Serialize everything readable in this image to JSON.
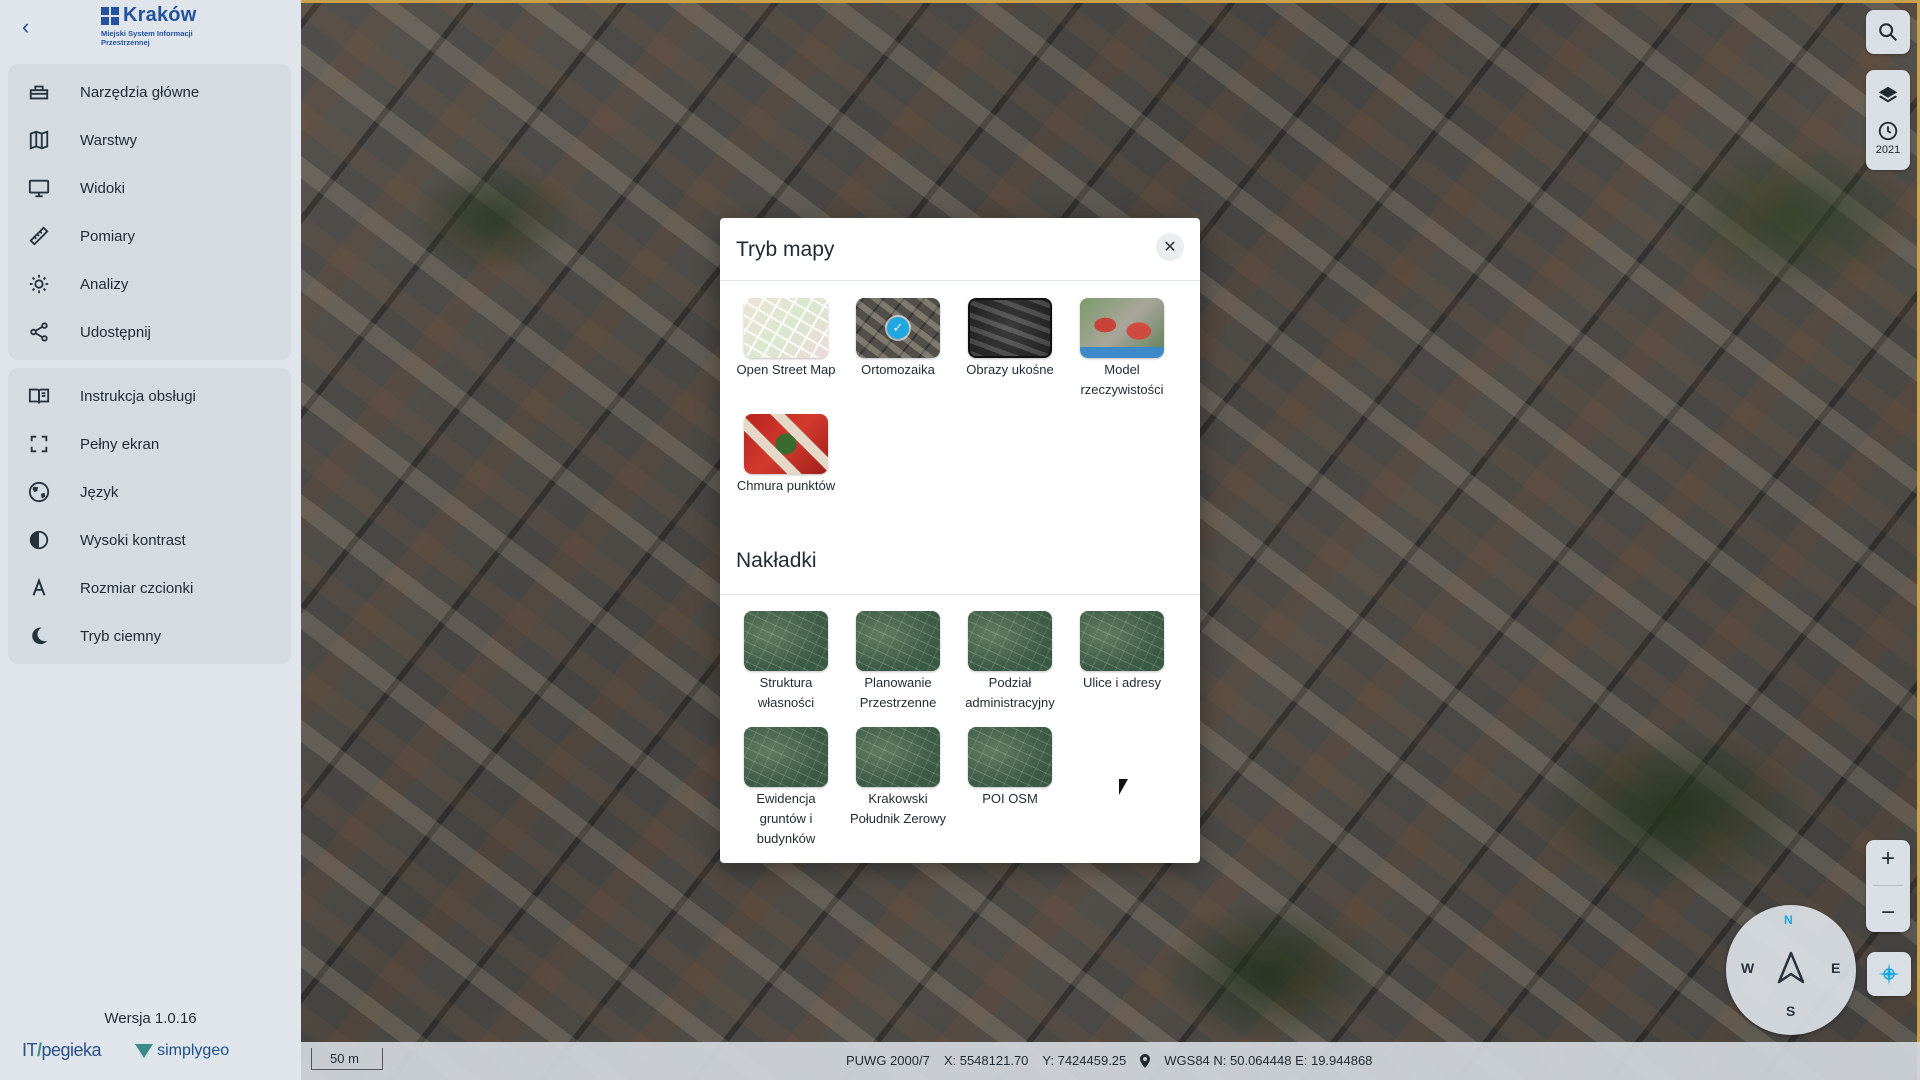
{
  "sidebar": {
    "logo": {
      "title": "Kraków",
      "subtitle": "Miejski System Informacji Przestrzennej"
    },
    "group1": [
      {
        "label": "Narzędzia główne",
        "icon": "toolbox-icon"
      },
      {
        "label": "Warstwy",
        "icon": "map-icon"
      },
      {
        "label": "Widoki",
        "icon": "monitor-icon"
      },
      {
        "label": "Pomiary",
        "icon": "ruler-icon"
      },
      {
        "label": "Analizy",
        "icon": "analysis-icon"
      },
      {
        "label": "Udostępnij",
        "icon": "share-icon"
      }
    ],
    "group2": [
      {
        "label": "Instrukcja obsługi",
        "icon": "book-icon"
      },
      {
        "label": "Pełny ekran",
        "icon": "fullscreen-icon"
      },
      {
        "label": "Język",
        "icon": "globe-icon"
      },
      {
        "label": "Wysoki kontrast",
        "icon": "contrast-icon"
      },
      {
        "label": "Rozmiar czcionki",
        "icon": "font-size-icon"
      },
      {
        "label": "Tryb ciemny",
        "icon": "moon-icon"
      }
    ],
    "version": "Wersja 1.0.16",
    "brands": {
      "it_a": "IT",
      "it_b": "pegieka",
      "simplygeo": "simplygeo"
    }
  },
  "modal": {
    "title": "Tryb mapy",
    "close": "✕",
    "modes": [
      {
        "label": "Open Street Map",
        "selected": false
      },
      {
        "label": "Ortomozaika",
        "selected": true
      },
      {
        "label": "Obrazy ukośne",
        "selected": false
      },
      {
        "label": "Model rzeczywistości",
        "selected": false
      },
      {
        "label": "Chmura punktów",
        "selected": false
      }
    ],
    "overlays_title": "Nakładki",
    "overlays": [
      {
        "label": "Struktura własności"
      },
      {
        "label": "Planowanie Przestrzenne"
      },
      {
        "label": "Podział administracyjny"
      },
      {
        "label": "Ulice i adresy"
      },
      {
        "label": "Ewidencja gruntów i budynków"
      },
      {
        "label": "Krakowski Południk Zerowy"
      },
      {
        "label": "POI OSM"
      }
    ]
  },
  "controls": {
    "year": "2021",
    "zoom_in": "+",
    "zoom_out": "−",
    "compass": {
      "n": "N",
      "s": "S",
      "w": "W",
      "e": "E"
    }
  },
  "status": {
    "scale": "50 m",
    "crs": "PUWG 2000/7",
    "x": "X: 5548121.70",
    "y": "Y: 7424459.25",
    "wgs": "WGS84 N: 50.064448 E: 19.944868"
  }
}
